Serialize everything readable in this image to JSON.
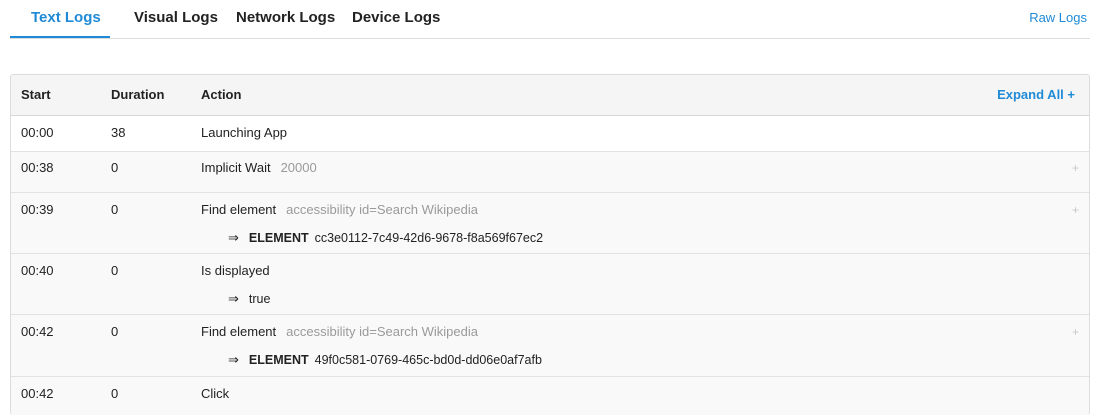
{
  "tabs": {
    "items": [
      {
        "label": "Text Logs",
        "active": true
      },
      {
        "label": "Visual Logs",
        "active": false
      },
      {
        "label": "Network Logs",
        "active": false
      },
      {
        "label": "Device Logs",
        "active": false
      }
    ],
    "raw_logs_label": "Raw Logs",
    "accent_color": "#1f8ad6"
  },
  "table": {
    "headers": {
      "start": "Start",
      "duration": "Duration",
      "action": "Action"
    },
    "expand_all_label": "Expand All +",
    "rows": [
      {
        "start": "00:00",
        "duration": "38",
        "action": "Launching App",
        "param": "",
        "expandable": false,
        "result_arrow": "",
        "result_label": "",
        "result_value": ""
      },
      {
        "start": "00:38",
        "duration": "0",
        "action": "Implicit Wait",
        "param": "20000",
        "expandable": true,
        "expand_icon": "+",
        "result_arrow": "",
        "result_label": "",
        "result_value": ""
      },
      {
        "start": "00:39",
        "duration": "0",
        "action": "Find element",
        "param": "accessibility id=Search Wikipedia",
        "expandable": true,
        "expand_icon": "+",
        "result_arrow": "⇒",
        "result_label": "ELEMENT",
        "result_value": "cc3e0112-7c49-42d6-9678-f8a569f67ec2"
      },
      {
        "start": "00:40",
        "duration": "0",
        "action": "Is displayed",
        "param": "",
        "expandable": false,
        "result_arrow": "⇒",
        "result_label": "",
        "result_value": "true"
      },
      {
        "start": "00:42",
        "duration": "0",
        "action": "Find element",
        "param": "accessibility id=Search Wikipedia",
        "expandable": true,
        "expand_icon": "+",
        "result_arrow": "⇒",
        "result_label": "ELEMENT",
        "result_value": "49f0c581-0769-465c-bd0d-dd06e0af7afb"
      },
      {
        "start": "00:42",
        "duration": "0",
        "action": "Click",
        "param": "",
        "expandable": false,
        "result_arrow": "",
        "result_label": "",
        "result_value": ""
      }
    ]
  }
}
